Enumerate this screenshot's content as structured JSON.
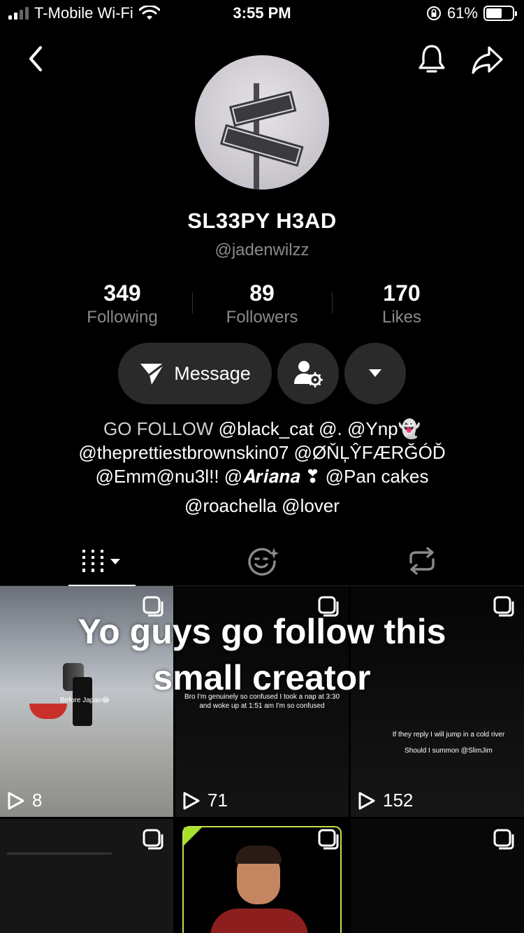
{
  "status_bar": {
    "carrier": "T-Mobile Wi-Fi",
    "time": "3:55 PM",
    "battery": "61%",
    "battery_level": 0.61
  },
  "profile": {
    "display_name": "SL33PY H3AD",
    "username": "@jadenwilzz",
    "stats": [
      {
        "value": "349",
        "label": "Following"
      },
      {
        "value": "89",
        "label": "Followers"
      },
      {
        "value": "170",
        "label": "Likes"
      }
    ]
  },
  "actions": {
    "message_label": "Message"
  },
  "bio": {
    "line1_prefix": "GO FOLLOW ",
    "line1_rest": "@black_cat @. @Ynp👻",
    "line2": "@theprettiestbrownskin07 @ØŇĻŶFÆRĞÓĎ",
    "line3": "@Emm@nu3l!! @𝑨𝒓𝒊𝒂𝒏𝒂 ❣ @Pan cakes",
    "line4": "@roachella @lover"
  },
  "grid": {
    "overlay_title_line1": "Yo guys go follow this",
    "overlay_title_line2": "small creator",
    "videos": [
      {
        "views": "8",
        "caption": "Before Japan😂"
      },
      {
        "views": "71",
        "caption_line1": "Bro I'm genuinely so confused I took a nap at 3:30",
        "caption_line2": "and woke up at 1:51 am I'm so confused"
      },
      {
        "views": "152",
        "caption_line1": "If they reply I will jump in a cold river",
        "caption_line2": "Should I summon @SlimJim"
      },
      {
        "views": ""
      },
      {
        "views": ""
      },
      {
        "views": ""
      }
    ]
  },
  "icons": {
    "back": "chevron-left-icon",
    "bell": "bell-icon",
    "share": "share-arrow-icon",
    "send": "send-icon",
    "person_settings": "person-gear-icon",
    "dropdown": "caret-down-icon",
    "videos_tab": "grid-bars-icon",
    "liked_tab": "face-sparkle-icon",
    "reposts_tab": "repost-icon",
    "multi": "multi-post-icon",
    "play": "play-outline-icon"
  },
  "colors": {
    "background": "#000000",
    "button_bg": "#2a2a2a",
    "muted_text": "#8a8a8a"
  }
}
